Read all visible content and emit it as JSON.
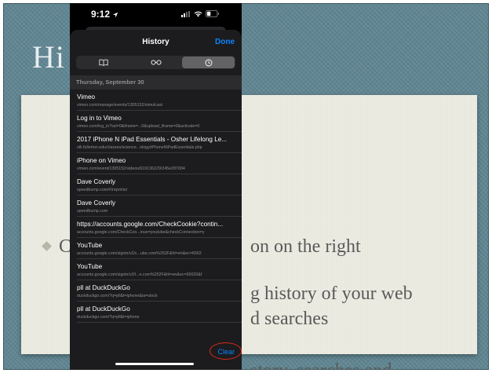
{
  "slide": {
    "title_visible": "Hi",
    "lines": [
      "C",
      "on on the right",
      "g history of your web",
      "d searches",
      "story, searches and"
    ]
  },
  "status_bar": {
    "time": "9:12",
    "icons": [
      "location-arrow-icon",
      "signal-icon",
      "wifi-icon",
      "battery-icon"
    ]
  },
  "sheet": {
    "title": "History",
    "done_label": "Done",
    "tabs": [
      "bookmarks-icon",
      "reading-list-icon",
      "history-clock-icon"
    ],
    "active_tab": "history-clock-icon",
    "section_header": "Thursday, September 30",
    "clear_label": "Clear"
  },
  "history": [
    {
      "title": "Vimeo",
      "url": "vimeo.com/manage/events/1305152/simulcast"
    },
    {
      "title": "Log in to Vimeo",
      "url": "vimeo.com/log_in?ssl=0&iframe=...0&upload_iframe=0&activate=0"
    },
    {
      "title": "2017 iPhone N iPad Essentials - Osher Lifelong Le...",
      "url": "olli.fullerton.edu/classes/science...ology/iPhoneNiPadEssentials.php"
    },
    {
      "title": "iPhone on Vimeo",
      "url": "vimeo.com/event/1305152/videos/619136229/245e287004"
    },
    {
      "title": "Dave Coverly",
      "url": "speedbump.com/#/reprints/"
    },
    {
      "title": "Dave Coverly",
      "url": "speedbump.com"
    },
    {
      "title": "https://accounts.google.com/CheckCookie?contin...",
      "url": "accounts.google.com/CheckCoo...inue=youtube&checkConnection=y"
    },
    {
      "title": "YouTube",
      "url": "accounts.google.com/signin/v2/c...ube.com%252F&hl=en&ec=6562"
    },
    {
      "title": "YouTube",
      "url": "accounts.google.com/signin/v2/l...e.com%252F&hl=en&ec=65620&f"
    },
    {
      "title": "pll at DuckDuckGo",
      "url": "duckduckgo.com/?q=pll&t=iphone&ia=stock"
    },
    {
      "title": "pll at DuckDuckGo",
      "url": "duckduckgo.com/?q=pll&t=iphone"
    }
  ],
  "colors": {
    "accent": "#0a84ff",
    "highlight_circle": "#e0281e",
    "slide_bg": "#5f8592",
    "panel_bg": "#ecebe1"
  }
}
